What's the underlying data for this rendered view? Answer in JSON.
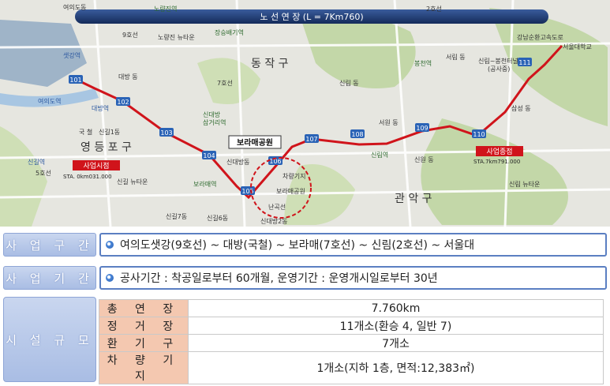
{
  "map": {
    "route_length": "노 선 연 장 (L = 7Km760)",
    "districts": [
      "동 작 구",
      "영 등 포 구",
      "관 악 구"
    ],
    "areas": [
      "여의도동",
      "노량진역",
      "노량진 뉴타운",
      "장승배기역",
      "9호선",
      "대방역",
      "대방 동",
      "7호선",
      "국 철",
      "신길1동",
      "신대방",
      "삼거리역",
      "신대방동",
      "신길 뉴타운",
      "보라매역",
      "신길7동",
      "신길6동",
      "신대방2동",
      "차량기지",
      "보라매공원",
      "난곡선",
      "신림 동",
      "신림역",
      "서원 동",
      "신원 동",
      "서림 동",
      "봉천역",
      "신림~봉천터널",
      "(공사중)",
      "강남순환고속도로",
      "서울대학교",
      "삼성 동",
      "신림 뉴타운",
      "2호선",
      "5호선",
      "신길역",
      "여의도역",
      "샛강역"
    ],
    "stations": [
      "101",
      "102",
      "103",
      "104",
      "105",
      "106",
      "107",
      "108",
      "109",
      "110",
      "111"
    ],
    "focus_label": "보라매공원",
    "start_label": "사업시점",
    "start_sta": "STA. 0km031.000",
    "end_label": "사업종점",
    "end_sta": "STA.7km791.000"
  },
  "project_section": {
    "label": "사 업 구 간",
    "value": "여의도샛강(9호선) ~ 대방(국철) ~ 보라매(7호선) ~ 신림(2호선) ~ 서울대"
  },
  "project_period": {
    "label": "사 업 기 간",
    "value": "공사기간 : 착공일로부터 60개월, 운영기간 : 운영개시일로부터 30년"
  },
  "facility": {
    "label": "시 설 규 모",
    "rows": [
      {
        "key": "총 연 장",
        "value": "7.760km"
      },
      {
        "key": "정 거 장",
        "value": "11개소(환승 4, 일반 7)"
      },
      {
        "key": "환 기 구",
        "value": "7개소"
      },
      {
        "key": "차 량 기 지",
        "value": "1개소(지하 1층, 면적:12,383㎡)"
      }
    ]
  },
  "colors": {
    "route": "#d0141b",
    "header_bg": "#1f3f7a",
    "label_bg": "#b6c7ea",
    "key_bg": "#f4c8b0"
  }
}
